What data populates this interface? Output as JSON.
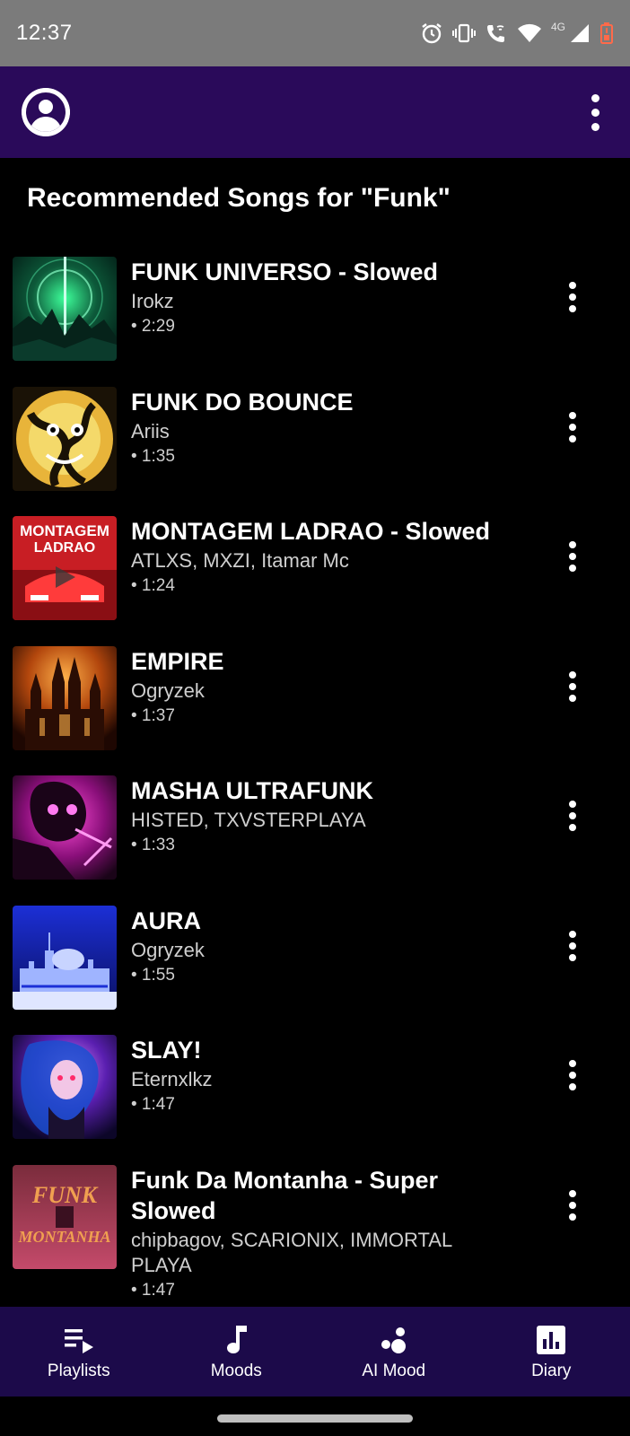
{
  "status_bar": {
    "time": "12:37",
    "network_label": "4G",
    "icons": [
      "alarm-icon",
      "vibrate-icon",
      "wifi-call-icon",
      "wifi-icon",
      "signal-icon",
      "battery-low-icon"
    ]
  },
  "app_bar": {
    "avatar_icon": "account-circle-icon",
    "menu_icon": "more-vert-icon",
    "bg_color": "#2a0a5a"
  },
  "section_title": "Recommended Songs for \"Funk\"",
  "songs": [
    {
      "title": "FUNK UNIVERSO - Slowed",
      "artist": "Irokz",
      "duration": "• 2:29"
    },
    {
      "title": "FUNK DO BOUNCE",
      "artist": "Ariis",
      "duration": "• 1:35"
    },
    {
      "title": "MONTAGEM LADRAO - Slowed",
      "artist": "ATLXS, MXZI, Itamar Mc",
      "duration": "• 1:24"
    },
    {
      "title": "EMPIRE",
      "artist": "Ogryzek",
      "duration": "• 1:37"
    },
    {
      "title": "MASHA ULTRAFUNK",
      "artist": "HISTED, TXVSTERPLAYA",
      "duration": "• 1:33"
    },
    {
      "title": "AURA",
      "artist": "Ogryzek",
      "duration": "• 1:55"
    },
    {
      "title": "SLAY!",
      "artist": "Eternxlkz",
      "duration": "• 1:47"
    },
    {
      "title": "Funk Da Montanha - Super Slowed",
      "artist": "chipbagov, SCARIONIX, IMMORTAL PLAYA",
      "duration": "• 1:47"
    }
  ],
  "covers": {
    "c3": "MONTAGEM",
    "c3b": "LADRAO",
    "c8a": "FUNK",
    "c8b": "MONTANHA"
  },
  "bottom_nav": {
    "bg_color": "#1c0a4a",
    "items": [
      {
        "label": "Playlists",
        "icon": "playlist-play-icon"
      },
      {
        "label": "Moods",
        "icon": "music-note-icon"
      },
      {
        "label": "AI Mood",
        "icon": "bubbles-icon"
      },
      {
        "label": "Diary",
        "icon": "bar-chart-icon"
      }
    ]
  }
}
